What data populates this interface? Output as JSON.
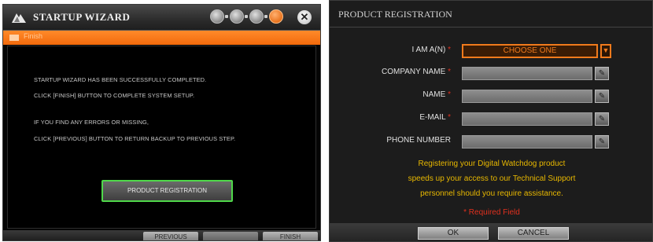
{
  "wizard": {
    "title": "STARTUP WIZARD",
    "banner_text": "Finish",
    "messages": [
      "STARTUP WIZARD HAS BEEN SUCCESSFULLY COMPLETED.",
      "CLICK [FINISH] BUTTON TO COMPLETE SYSTEM SETUP.",
      "IF YOU FIND ANY ERRORS OR MISSING,",
      "CLICK [PREVIOUS] BUTTON TO RETURN BACKUP TO PREVIOUS STEP."
    ],
    "product_registration_label": "PRODUCT REGISTRATION",
    "footer": {
      "previous_label": "PREVIOUS",
      "finish_label": "FINISH"
    },
    "step_icons": [
      "globe-icon",
      "monitor-icon",
      "display-icon",
      "flag-icon"
    ],
    "accent_color": "#f26a0c",
    "highlight_color": "#4fd84a"
  },
  "registration": {
    "title": "PRODUCT REGISTRATION",
    "fields": {
      "i_am": {
        "label": "I AM A(N)",
        "required_mark": "*",
        "value": "CHOOSE ONE"
      },
      "company": {
        "label": "COMPANY NAME",
        "required_mark": "*",
        "value": ""
      },
      "name": {
        "label": "NAME",
        "required_mark": "*",
        "value": ""
      },
      "email": {
        "label": "E-MAIL",
        "required_mark": "*",
        "value": ""
      },
      "phone": {
        "label": "PHONE NUMBER",
        "required_mark": "",
        "value": ""
      }
    },
    "info_lines": [
      "Registering your Digital Watchdog product",
      "speeds up your access to our Technical Support",
      "personnel should you require assistance."
    ],
    "required_note": "* Required Field",
    "ok_label": "OK",
    "cancel_label": "CANCEL",
    "accent_color": "#f07a1c",
    "info_color": "#e8b800",
    "required_color": "#e0301e"
  }
}
